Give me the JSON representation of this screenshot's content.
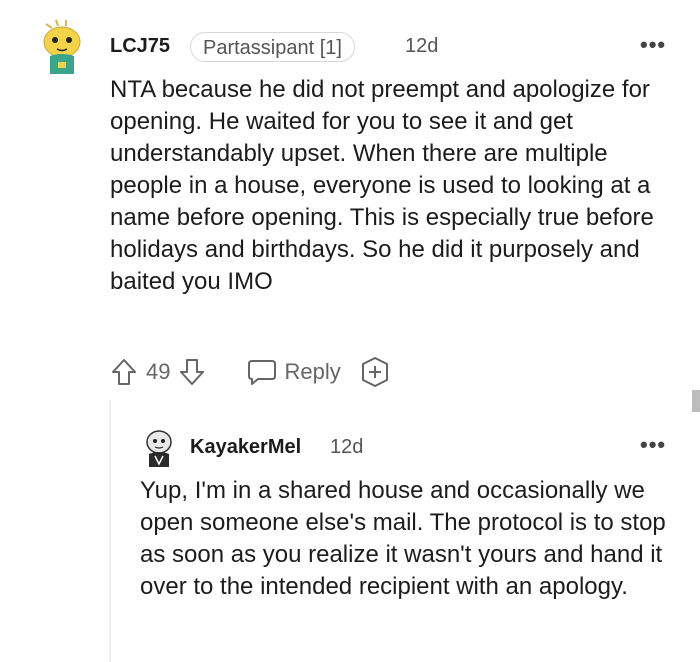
{
  "comments": [
    {
      "username": "LCJ75",
      "flair": "Partassipant [1]",
      "time": "12d",
      "more_label": "•••",
      "text": "NTA because he did not preempt and apologize for opening. He waited for you to see it and get understandably upset. When there are multiple people in a house, everyone is used to looking at a name before opening. This is especially true before holidays and birthdays. So he did it purposely and baited you IMO",
      "votes": "49",
      "reply_label": "Reply"
    },
    {
      "username": "KayakerMel",
      "time": "12d",
      "more_label": "•••",
      "text": "Yup, I'm in a shared house and occasionally we open someone else's mail. The protocol is to stop as soon as you realize it wasn't yours and hand it over to the intended recipient with an apology."
    }
  ],
  "icons": {
    "upvote": "arrow-up-icon",
    "downvote": "arrow-down-icon",
    "reply": "speech-bubble-icon",
    "award": "plus-award-icon"
  },
  "colors": {
    "avatar1_bg": "#f3d34a",
    "avatar1_body": "#3aa58b",
    "avatar2_body": "#2a2a2a",
    "text": "#1c1c1c",
    "meta": "#555555"
  }
}
